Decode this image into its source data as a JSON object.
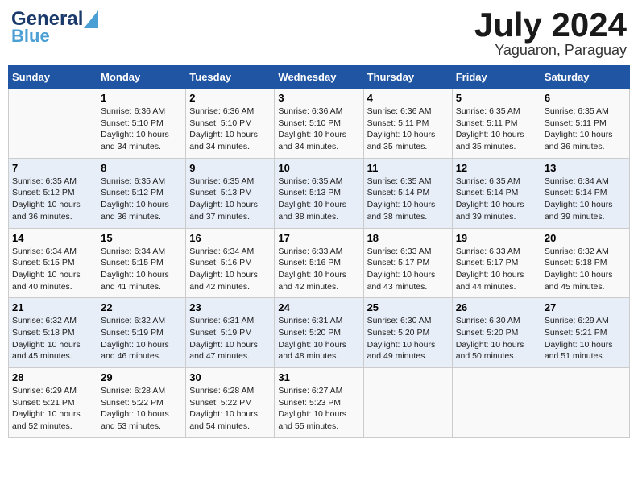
{
  "header": {
    "logo_general": "General",
    "logo_blue": "Blue",
    "month_title": "July 2024",
    "location": "Yaguaron, Paraguay"
  },
  "columns": [
    "Sunday",
    "Monday",
    "Tuesday",
    "Wednesday",
    "Thursday",
    "Friday",
    "Saturday"
  ],
  "weeks": [
    [
      {
        "day": "",
        "detail": ""
      },
      {
        "day": "1",
        "detail": "Sunrise: 6:36 AM\nSunset: 5:10 PM\nDaylight: 10 hours\nand 34 minutes."
      },
      {
        "day": "2",
        "detail": "Sunrise: 6:36 AM\nSunset: 5:10 PM\nDaylight: 10 hours\nand 34 minutes."
      },
      {
        "day": "3",
        "detail": "Sunrise: 6:36 AM\nSunset: 5:10 PM\nDaylight: 10 hours\nand 34 minutes."
      },
      {
        "day": "4",
        "detail": "Sunrise: 6:36 AM\nSunset: 5:11 PM\nDaylight: 10 hours\nand 35 minutes."
      },
      {
        "day": "5",
        "detail": "Sunrise: 6:35 AM\nSunset: 5:11 PM\nDaylight: 10 hours\nand 35 minutes."
      },
      {
        "day": "6",
        "detail": "Sunrise: 6:35 AM\nSunset: 5:11 PM\nDaylight: 10 hours\nand 36 minutes."
      }
    ],
    [
      {
        "day": "7",
        "detail": "Sunrise: 6:35 AM\nSunset: 5:12 PM\nDaylight: 10 hours\nand 36 minutes."
      },
      {
        "day": "8",
        "detail": "Sunrise: 6:35 AM\nSunset: 5:12 PM\nDaylight: 10 hours\nand 36 minutes."
      },
      {
        "day": "9",
        "detail": "Sunrise: 6:35 AM\nSunset: 5:13 PM\nDaylight: 10 hours\nand 37 minutes."
      },
      {
        "day": "10",
        "detail": "Sunrise: 6:35 AM\nSunset: 5:13 PM\nDaylight: 10 hours\nand 38 minutes."
      },
      {
        "day": "11",
        "detail": "Sunrise: 6:35 AM\nSunset: 5:14 PM\nDaylight: 10 hours\nand 38 minutes."
      },
      {
        "day": "12",
        "detail": "Sunrise: 6:35 AM\nSunset: 5:14 PM\nDaylight: 10 hours\nand 39 minutes."
      },
      {
        "day": "13",
        "detail": "Sunrise: 6:34 AM\nSunset: 5:14 PM\nDaylight: 10 hours\nand 39 minutes."
      }
    ],
    [
      {
        "day": "14",
        "detail": "Sunrise: 6:34 AM\nSunset: 5:15 PM\nDaylight: 10 hours\nand 40 minutes."
      },
      {
        "day": "15",
        "detail": "Sunrise: 6:34 AM\nSunset: 5:15 PM\nDaylight: 10 hours\nand 41 minutes."
      },
      {
        "day": "16",
        "detail": "Sunrise: 6:34 AM\nSunset: 5:16 PM\nDaylight: 10 hours\nand 42 minutes."
      },
      {
        "day": "17",
        "detail": "Sunrise: 6:33 AM\nSunset: 5:16 PM\nDaylight: 10 hours\nand 42 minutes."
      },
      {
        "day": "18",
        "detail": "Sunrise: 6:33 AM\nSunset: 5:17 PM\nDaylight: 10 hours\nand 43 minutes."
      },
      {
        "day": "19",
        "detail": "Sunrise: 6:33 AM\nSunset: 5:17 PM\nDaylight: 10 hours\nand 44 minutes."
      },
      {
        "day": "20",
        "detail": "Sunrise: 6:32 AM\nSunset: 5:18 PM\nDaylight: 10 hours\nand 45 minutes."
      }
    ],
    [
      {
        "day": "21",
        "detail": "Sunrise: 6:32 AM\nSunset: 5:18 PM\nDaylight: 10 hours\nand 45 minutes."
      },
      {
        "day": "22",
        "detail": "Sunrise: 6:32 AM\nSunset: 5:19 PM\nDaylight: 10 hours\nand 46 minutes."
      },
      {
        "day": "23",
        "detail": "Sunrise: 6:31 AM\nSunset: 5:19 PM\nDaylight: 10 hours\nand 47 minutes."
      },
      {
        "day": "24",
        "detail": "Sunrise: 6:31 AM\nSunset: 5:20 PM\nDaylight: 10 hours\nand 48 minutes."
      },
      {
        "day": "25",
        "detail": "Sunrise: 6:30 AM\nSunset: 5:20 PM\nDaylight: 10 hours\nand 49 minutes."
      },
      {
        "day": "26",
        "detail": "Sunrise: 6:30 AM\nSunset: 5:20 PM\nDaylight: 10 hours\nand 50 minutes."
      },
      {
        "day": "27",
        "detail": "Sunrise: 6:29 AM\nSunset: 5:21 PM\nDaylight: 10 hours\nand 51 minutes."
      }
    ],
    [
      {
        "day": "28",
        "detail": "Sunrise: 6:29 AM\nSunset: 5:21 PM\nDaylight: 10 hours\nand 52 minutes."
      },
      {
        "day": "29",
        "detail": "Sunrise: 6:28 AM\nSunset: 5:22 PM\nDaylight: 10 hours\nand 53 minutes."
      },
      {
        "day": "30",
        "detail": "Sunrise: 6:28 AM\nSunset: 5:22 PM\nDaylight: 10 hours\nand 54 minutes."
      },
      {
        "day": "31",
        "detail": "Sunrise: 6:27 AM\nSunset: 5:23 PM\nDaylight: 10 hours\nand 55 minutes."
      },
      {
        "day": "",
        "detail": ""
      },
      {
        "day": "",
        "detail": ""
      },
      {
        "day": "",
        "detail": ""
      }
    ]
  ]
}
